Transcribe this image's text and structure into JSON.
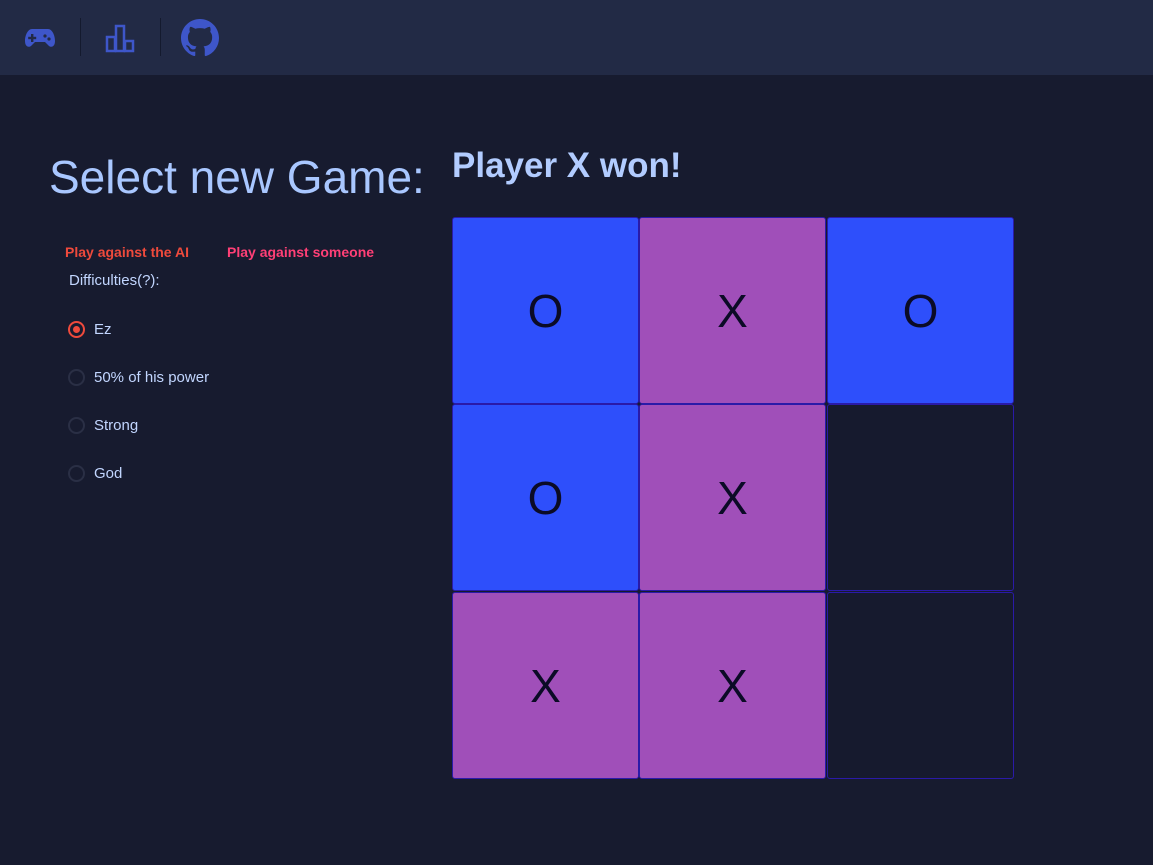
{
  "nav": {
    "items": [
      {
        "icon": "gamepad-icon"
      },
      {
        "icon": "leaderboard-icon"
      },
      {
        "icon": "github-icon"
      }
    ],
    "icon_color": "#3e56c9"
  },
  "left": {
    "title": "Select new Game:",
    "mode_ai": "Play against the AI",
    "mode_someone": "Play against someone",
    "difficulties_label": "Difficulties(?):",
    "options": [
      {
        "label": "Ez",
        "checked": true
      },
      {
        "label": "50% of his power",
        "checked": false
      },
      {
        "label": "Strong",
        "checked": false
      },
      {
        "label": "God",
        "checked": false
      }
    ]
  },
  "status": "Player X won!",
  "board": {
    "cells": [
      "O",
      "X",
      "O",
      "O",
      "X",
      "",
      "X",
      "X",
      ""
    ]
  },
  "colors": {
    "o_cell": "#2e4ffb",
    "x_cell": "#a04fb9",
    "empty_cell": "#161a2e",
    "mode_ai": "#ef4a3c",
    "mode_someone": "#ff3f76"
  }
}
